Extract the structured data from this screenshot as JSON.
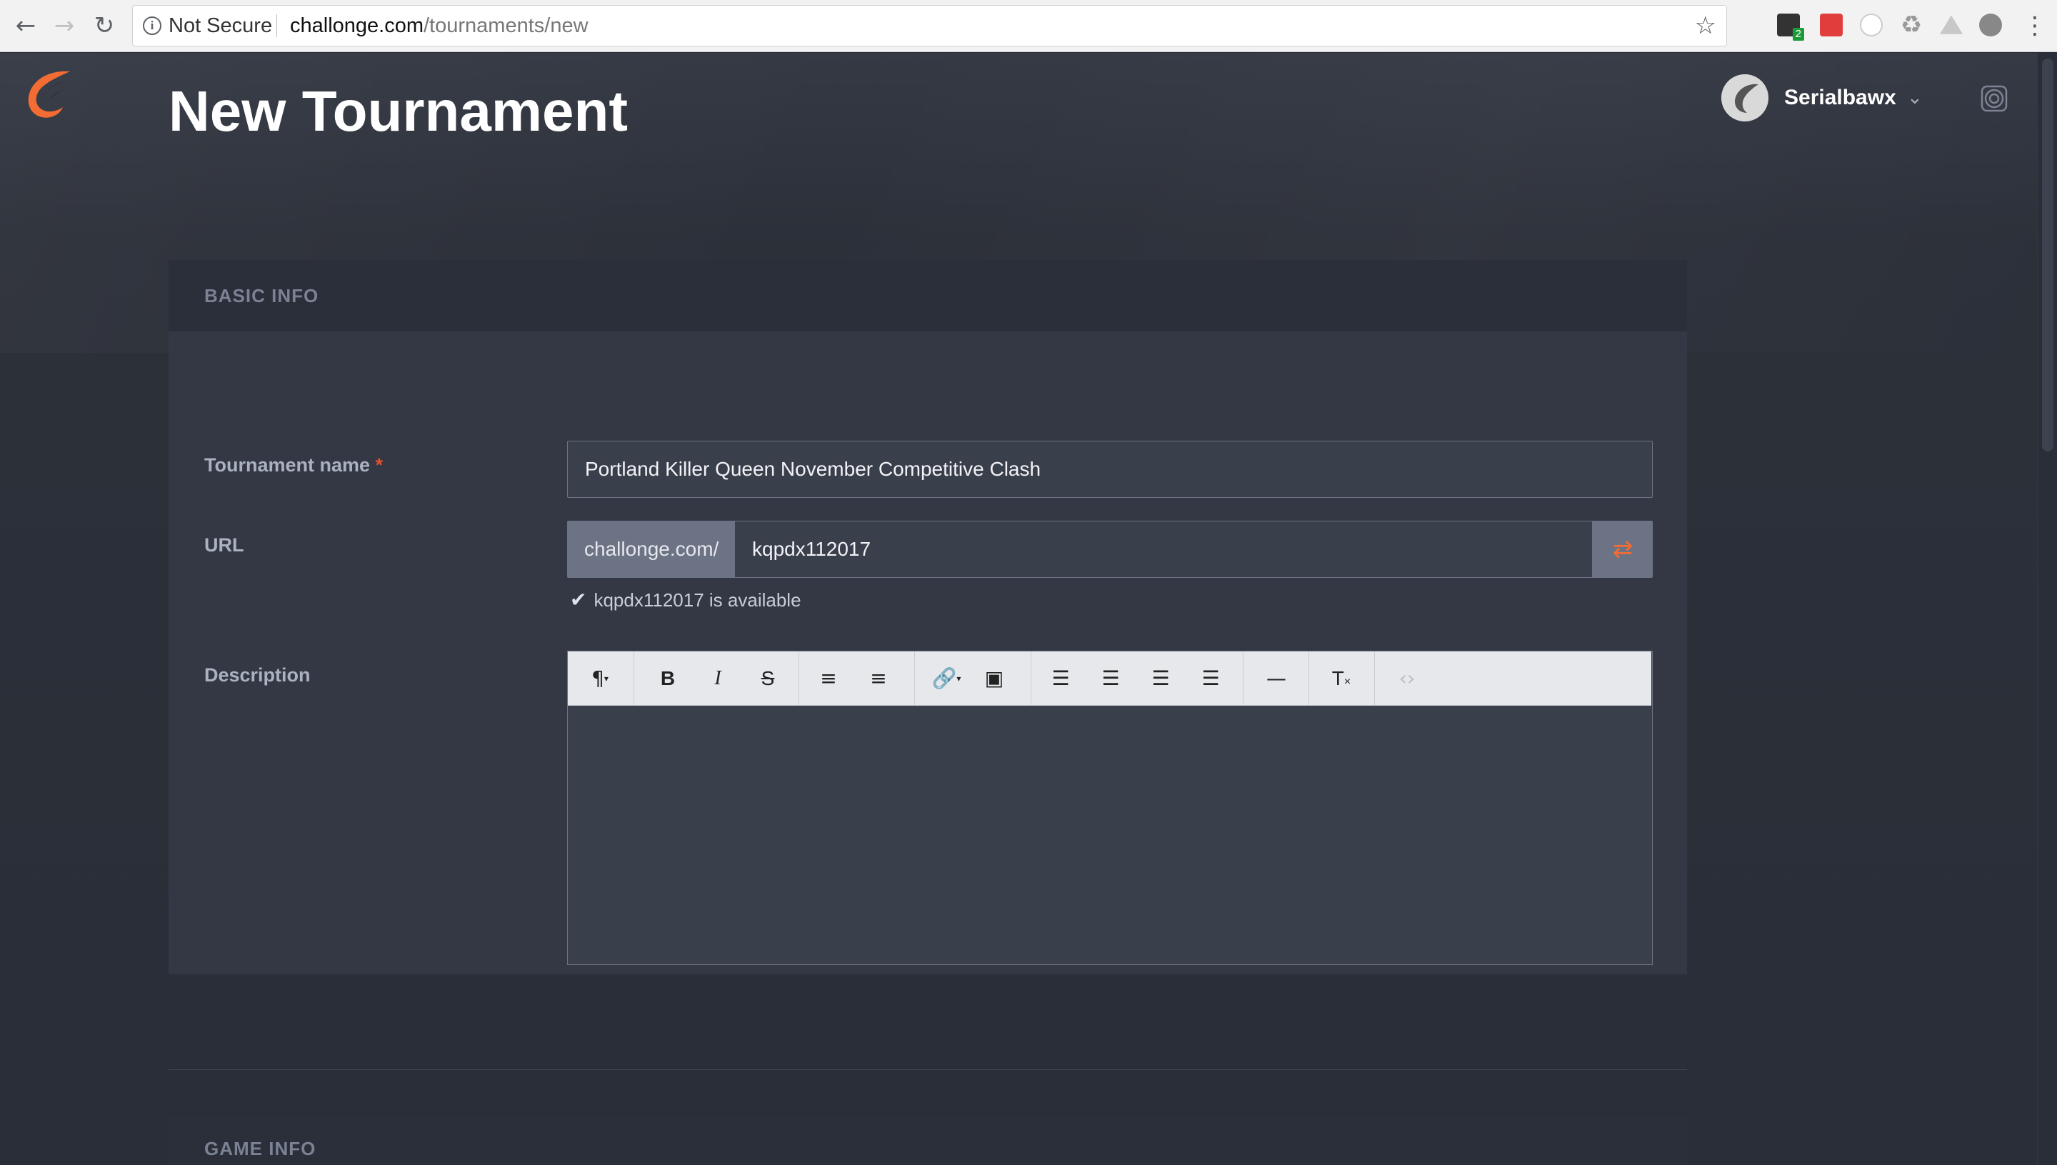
{
  "browser": {
    "security_label": "Not Secure",
    "url_host": "challonge.com",
    "url_path": "/tournaments/new",
    "extension_badge": "2"
  },
  "header": {
    "username": "Serialbawx"
  },
  "page": {
    "title": "New Tournament"
  },
  "basic_info": {
    "section_label": "BASIC INFO",
    "tournament_name": {
      "label": "Tournament name",
      "required_marker": "*",
      "value": "Portland Killer Queen November Competitive Clash"
    },
    "url": {
      "label": "URL",
      "prefix": "challonge.com/",
      "value": "kqpdx112017",
      "availability_message": "kqpdx112017 is available"
    },
    "description": {
      "label": "Description"
    }
  },
  "game_info": {
    "section_label": "GAME INFO"
  },
  "colors": {
    "brand": "#f26c34",
    "background": "#2a2e38",
    "panel": "#333844"
  }
}
